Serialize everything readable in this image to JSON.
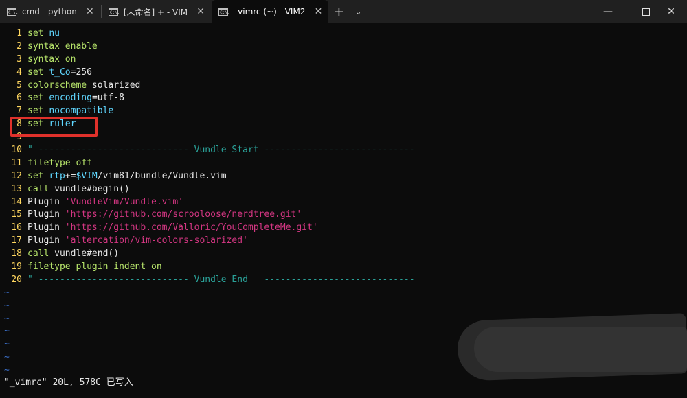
{
  "tabs": [
    {
      "label": "cmd - python",
      "close": "✕",
      "active": false
    },
    {
      "label": "[未命名] + - VIM",
      "close": "✕",
      "active": false
    },
    {
      "label": "_vimrc (~) - VIM2",
      "close": "✕",
      "active": true
    }
  ],
  "tab_icon_text": "C:\\.",
  "new_tab": "+",
  "dropdown": "⌄",
  "window_controls": {
    "minimize": "—",
    "close": "✕"
  },
  "lines": [
    {
      "num": "1",
      "segs": [
        {
          "t": "set",
          "c": "kw"
        },
        {
          "t": " ",
          "c": "plain"
        },
        {
          "t": "nu",
          "c": "opt"
        }
      ]
    },
    {
      "num": "2",
      "segs": [
        {
          "t": "syntax",
          "c": "kw"
        },
        {
          "t": " ",
          "c": "plain"
        },
        {
          "t": "enable",
          "c": "kw"
        }
      ]
    },
    {
      "num": "3",
      "segs": [
        {
          "t": "syntax",
          "c": "kw"
        },
        {
          "t": " ",
          "c": "plain"
        },
        {
          "t": "on",
          "c": "kw"
        }
      ]
    },
    {
      "num": "4",
      "segs": [
        {
          "t": "set",
          "c": "kw"
        },
        {
          "t": " ",
          "c": "plain"
        },
        {
          "t": "t_Co",
          "c": "opt"
        },
        {
          "t": "=256",
          "c": "plain"
        }
      ]
    },
    {
      "num": "5",
      "segs": [
        {
          "t": "colorscheme",
          "c": "kw"
        },
        {
          "t": " solarized",
          "c": "plain"
        }
      ]
    },
    {
      "num": "6",
      "segs": [
        {
          "t": "set",
          "c": "kw"
        },
        {
          "t": " ",
          "c": "plain"
        },
        {
          "t": "encoding",
          "c": "opt"
        },
        {
          "t": "=utf-8",
          "c": "plain"
        }
      ]
    },
    {
      "num": "7",
      "segs": [
        {
          "t": "set",
          "c": "kw"
        },
        {
          "t": " ",
          "c": "plain"
        },
        {
          "t": "nocompatible",
          "c": "opt"
        }
      ]
    },
    {
      "num": "8",
      "segs": [
        {
          "t": "set",
          "c": "kw"
        },
        {
          "t": " ",
          "c": "plain"
        },
        {
          "t": "ruler",
          "c": "opt"
        }
      ]
    },
    {
      "num": "9",
      "segs": []
    },
    {
      "num": "10",
      "segs": [
        {
          "t": "\" ---------------------------- Vundle Start ----------------------------",
          "c": "cmt"
        }
      ]
    },
    {
      "num": "11",
      "segs": [
        {
          "t": "filetype",
          "c": "kw"
        },
        {
          "t": " ",
          "c": "plain"
        },
        {
          "t": "off",
          "c": "kw"
        }
      ]
    },
    {
      "num": "12",
      "segs": [
        {
          "t": "set",
          "c": "kw"
        },
        {
          "t": " ",
          "c": "plain"
        },
        {
          "t": "rtp",
          "c": "opt"
        },
        {
          "t": "+=",
          "c": "plain"
        },
        {
          "t": "$VIM",
          "c": "opt"
        },
        {
          "t": "/vim81/bundle/Vundle.vim",
          "c": "plain"
        }
      ]
    },
    {
      "num": "13",
      "segs": [
        {
          "t": "call",
          "c": "kw"
        },
        {
          "t": " vundle#begin()",
          "c": "plain"
        }
      ]
    },
    {
      "num": "14",
      "segs": [
        {
          "t": "Plugin ",
          "c": "plain"
        },
        {
          "t": "'VundleVim/Vundle.vim'",
          "c": "str"
        }
      ]
    },
    {
      "num": "15",
      "segs": [
        {
          "t": "Plugin ",
          "c": "plain"
        },
        {
          "t": "'https://github.com/scrooloose/nerdtree.git'",
          "c": "str"
        }
      ]
    },
    {
      "num": "16",
      "segs": [
        {
          "t": "Plugin ",
          "c": "plain"
        },
        {
          "t": "'https://github.com/Valloric/YouCompleteMe.git'",
          "c": "str"
        }
      ]
    },
    {
      "num": "17",
      "segs": [
        {
          "t": "Plugin ",
          "c": "plain"
        },
        {
          "t": "'altercation/vim-colors-solarized'",
          "c": "str"
        }
      ]
    },
    {
      "num": "18",
      "segs": [
        {
          "t": "call",
          "c": "kw"
        },
        {
          "t": " vundle#end()",
          "c": "plain"
        }
      ]
    },
    {
      "num": "19",
      "segs": [
        {
          "t": "filetype",
          "c": "kw"
        },
        {
          "t": " ",
          "c": "plain"
        },
        {
          "t": "plugin",
          "c": "kw"
        },
        {
          "t": " ",
          "c": "plain"
        },
        {
          "t": "indent",
          "c": "kw"
        },
        {
          "t": " ",
          "c": "plain"
        },
        {
          "t": "on",
          "c": "kw"
        }
      ]
    },
    {
      "num": "20",
      "segs": [
        {
          "t": "\" ---------------------------- Vundle End   ----------------------------",
          "c": "cmt"
        }
      ]
    }
  ],
  "tilde_char": "~",
  "tilde_count": 7,
  "status": "\"_vimrc\" 20L, 578C 已写入",
  "colors": {
    "background": "#0c0c0c",
    "tabbar": "#202020",
    "line_number": "#ffd75f",
    "keyword": "#b6e36a",
    "option": "#5fd7ff",
    "string": "#d33682",
    "comment": "#2aa198",
    "highlight_box": "#e0312b",
    "tilde": "#3b6fc9"
  }
}
